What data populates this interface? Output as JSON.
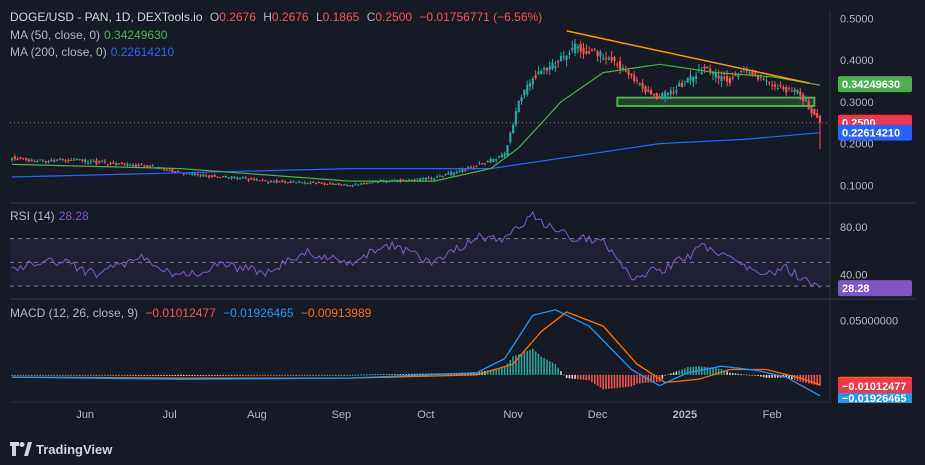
{
  "legend": {
    "symbol": "DOGE/USD - PAN, 1D, DEXTools.io",
    "o_label": "O",
    "o": "0.2676",
    "h_label": "H",
    "h": "0.2676",
    "l_label": "L",
    "l": "0.1865",
    "c_label": "C",
    "c": "0.2500",
    "change": "−0.01756771 (−6.56%)",
    "ma50_label": "MA (50, close, 0)",
    "ma50": "0.34249630",
    "ma200_label": "MA (200, close, 0)",
    "ma200": "0.22614210",
    "rsi_label": "RSI (14)",
    "rsi": "28.28",
    "macd_label": "MACD (12, 26, close, 9)",
    "macd_hist": "−0.01012477",
    "macd_line": "−0.01926465",
    "macd_signal": "−0.00913989"
  },
  "footer": {
    "logo_text": "TradingView"
  },
  "colors": {
    "up": "#26a69a",
    "down": "#ef5350",
    "ma50": "#4caf50",
    "ma200": "#2962ff",
    "rsi": "#7e57c2",
    "macd": "#2196f3",
    "signal": "#ff6d00",
    "trendline": "#ff9800",
    "support": "#4caf50"
  },
  "chart_data": [
    {
      "type": "candlestick",
      "title": "DOGE/USD - PAN, 1D, DEXTools.io",
      "x_ticks": [
        "Jun",
        "Jul",
        "Aug",
        "Sep",
        "Oct",
        "Nov",
        "Dec",
        "2025",
        "Feb"
      ],
      "y_ticks": [
        "0.1000",
        "0.2000",
        "0.3000",
        "0.4000",
        "0.5000"
      ],
      "ylim": [
        0.06,
        0.52
      ],
      "price_path": [
        [
          0,
          0.165
        ],
        [
          10,
          0.158
        ],
        [
          20,
          0.162
        ],
        [
          30,
          0.155
        ],
        [
          40,
          0.15
        ],
        [
          50,
          0.145
        ],
        [
          60,
          0.13
        ],
        [
          70,
          0.122
        ],
        [
          80,
          0.118
        ],
        [
          90,
          0.11
        ],
        [
          100,
          0.108
        ],
        [
          110,
          0.105
        ],
        [
          120,
          0.1
        ],
        [
          130,
          0.11
        ],
        [
          140,
          0.112
        ],
        [
          150,
          0.118
        ],
        [
          160,
          0.135
        ],
        [
          170,
          0.16
        ],
        [
          175,
          0.175
        ],
        [
          180,
          0.3
        ],
        [
          185,
          0.36
        ],
        [
          190,
          0.38
        ],
        [
          195,
          0.4
        ],
        [
          200,
          0.43
        ],
        [
          205,
          0.42
        ],
        [
          210,
          0.41
        ],
        [
          215,
          0.39
        ],
        [
          220,
          0.36
        ],
        [
          225,
          0.33
        ],
        [
          230,
          0.31
        ],
        [
          235,
          0.33
        ],
        [
          240,
          0.35
        ],
        [
          245,
          0.38
        ],
        [
          250,
          0.36
        ],
        [
          255,
          0.35
        ],
        [
          260,
          0.38
        ],
        [
          265,
          0.36
        ],
        [
          270,
          0.34
        ],
        [
          275,
          0.33
        ],
        [
          280,
          0.32
        ],
        [
          285,
          0.2676
        ],
        [
          287,
          0.25
        ]
      ],
      "ohlc_last": {
        "open": 0.2676,
        "high": 0.2676,
        "low": 0.1865,
        "close": 0.25
      },
      "ma50_path": [
        [
          0,
          0.15
        ],
        [
          60,
          0.14
        ],
        [
          120,
          0.11
        ],
        [
          150,
          0.11
        ],
        [
          170,
          0.14
        ],
        [
          180,
          0.19
        ],
        [
          195,
          0.3
        ],
        [
          210,
          0.37
        ],
        [
          230,
          0.39
        ],
        [
          250,
          0.37
        ],
        [
          270,
          0.36
        ],
        [
          287,
          0.34
        ]
      ],
      "ma200_path": [
        [
          0,
          0.12
        ],
        [
          60,
          0.13
        ],
        [
          120,
          0.14
        ],
        [
          170,
          0.14
        ],
        [
          200,
          0.17
        ],
        [
          230,
          0.2
        ],
        [
          260,
          0.21
        ],
        [
          287,
          0.2261
        ]
      ],
      "trendline": [
        [
          197,
          0.47
        ],
        [
          283,
          0.345
        ]
      ],
      "support_zone": {
        "x": [
          215,
          285
        ],
        "y": [
          0.29,
          0.31
        ]
      },
      "last_price": 0.25,
      "ma50_last": 0.3425,
      "ma200_last": 0.2261
    },
    {
      "type": "line",
      "title": "RSI (14)",
      "y_ticks": [
        "40.00",
        "80.00"
      ],
      "ylim": [
        20,
        100
      ],
      "levels": [
        70,
        50,
        30
      ],
      "path": [
        [
          0,
          45
        ],
        [
          15,
          52
        ],
        [
          30,
          40
        ],
        [
          45,
          55
        ],
        [
          60,
          38
        ],
        [
          75,
          48
        ],
        [
          90,
          42
        ],
        [
          105,
          58
        ],
        [
          120,
          50
        ],
        [
          135,
          66
        ],
        [
          150,
          48
        ],
        [
          165,
          72
        ],
        [
          175,
          70
        ],
        [
          185,
          90
        ],
        [
          190,
          80
        ],
        [
          200,
          70
        ],
        [
          210,
          68
        ],
        [
          220,
          38
        ],
        [
          232,
          45
        ],
        [
          245,
          62
        ],
        [
          255,
          56
        ],
        [
          265,
          40
        ],
        [
          275,
          45
        ],
        [
          287,
          28.28
        ]
      ],
      "last": 28.28
    },
    {
      "type": "line",
      "title": "MACD (12, 26, close, 9)",
      "y_ticks": [
        "0.05000000"
      ],
      "ylim": [
        -0.025,
        0.07
      ],
      "macd_path": [
        [
          0,
          -0.002
        ],
        [
          60,
          -0.004
        ],
        [
          120,
          -0.003
        ],
        [
          165,
          0.002
        ],
        [
          175,
          0.015
        ],
        [
          185,
          0.055
        ],
        [
          193,
          0.06
        ],
        [
          205,
          0.045
        ],
        [
          220,
          0.005
        ],
        [
          230,
          -0.01
        ],
        [
          240,
          0.002
        ],
        [
          252,
          0.008
        ],
        [
          265,
          0.004
        ],
        [
          275,
          -0.002
        ],
        [
          287,
          -0.0193
        ]
      ],
      "signal_path": [
        [
          0,
          -0.002
        ],
        [
          60,
          -0.003
        ],
        [
          120,
          -0.003
        ],
        [
          165,
          0.0
        ],
        [
          178,
          0.01
        ],
        [
          188,
          0.04
        ],
        [
          197,
          0.058
        ],
        [
          210,
          0.045
        ],
        [
          222,
          0.01
        ],
        [
          232,
          -0.007
        ],
        [
          244,
          -0.004
        ],
        [
          255,
          0.005
        ],
        [
          268,
          0.005
        ],
        [
          280,
          -0.003
        ],
        [
          287,
          -0.0091
        ]
      ],
      "macd_last": -0.01926465,
      "signal_last": -0.00913989,
      "hist_last": -0.01012477
    }
  ]
}
